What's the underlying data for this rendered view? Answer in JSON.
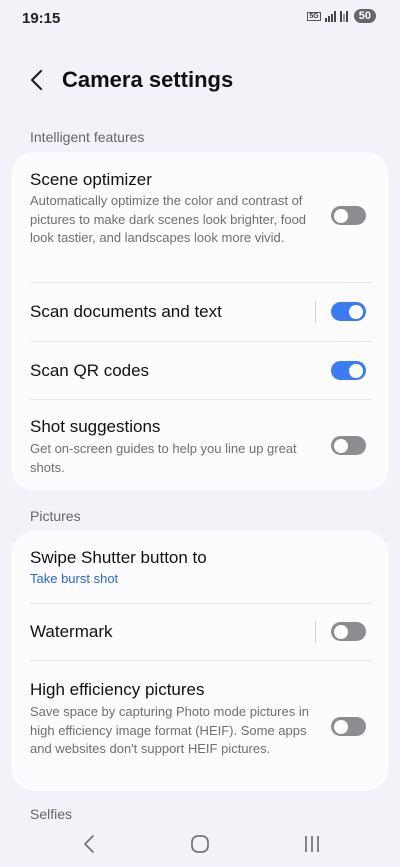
{
  "status_bar": {
    "time": "19:15",
    "network_badge": "5G",
    "battery": "50"
  },
  "header": {
    "title": "Camera settings",
    "back_icon": "chevron-left-icon"
  },
  "sections": {
    "intelligent_features": {
      "label": "Intelligent features",
      "items": {
        "scene_optimizer": {
          "title": "Scene optimizer",
          "description": "Automatically optimize the color and contrast of pictures to make dark scenes look brighter, food look tastier, and landscapes look more vivid.",
          "enabled": false
        },
        "scan_documents": {
          "title": "Scan documents and text",
          "enabled": true
        },
        "scan_qr": {
          "title": "Scan QR codes",
          "enabled": true
        },
        "shot_suggestions": {
          "title": "Shot suggestions",
          "description": "Get on-screen guides to help you line up great shots.",
          "enabled": false
        }
      }
    },
    "pictures": {
      "label": "Pictures",
      "items": {
        "swipe_shutter": {
          "title": "Swipe Shutter button to",
          "value": "Take burst shot"
        },
        "watermark": {
          "title": "Watermark",
          "enabled": false
        },
        "high_efficiency": {
          "title": "High efficiency pictures",
          "description": "Save space by capturing Photo mode pictures in high efficiency image format (HEIF). Some apps and websites don't support HEIF pictures.",
          "enabled": false
        }
      }
    },
    "selfies": {
      "label": "Selfies"
    }
  },
  "colors": {
    "accent": "#3d7bf0",
    "toggle_off": "#8d8d91",
    "link": "#2a66c9",
    "background": "#f2f3f8",
    "card": "#fcfcfe"
  },
  "nav_bar": {
    "back_icon": "nav-back-icon",
    "home_icon": "nav-home-icon",
    "recents_icon": "nav-recents-icon"
  }
}
